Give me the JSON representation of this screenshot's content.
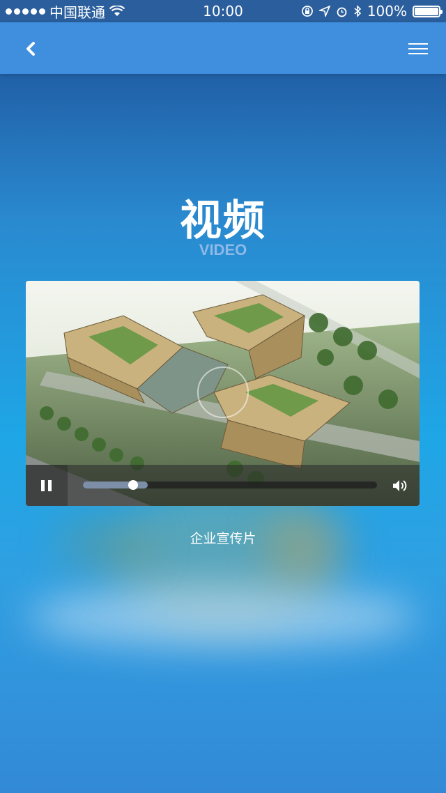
{
  "status_bar": {
    "carrier": "中国联通",
    "time": "10:00",
    "battery": "100%"
  },
  "nav": {
    "back_icon": "chevron-left-icon",
    "menu_icon": "hamburger-menu-icon"
  },
  "page": {
    "title": "视频",
    "subtitle": "VIDEO"
  },
  "video": {
    "caption": "企业宣传片",
    "progress_fraction": 0.17,
    "buffered_fraction": 0.22,
    "state": "playing"
  },
  "colors": {
    "nav_bar": "#3f8fde",
    "status_bar": "#2a5e9c",
    "subtitle": "#8fb9e6"
  }
}
